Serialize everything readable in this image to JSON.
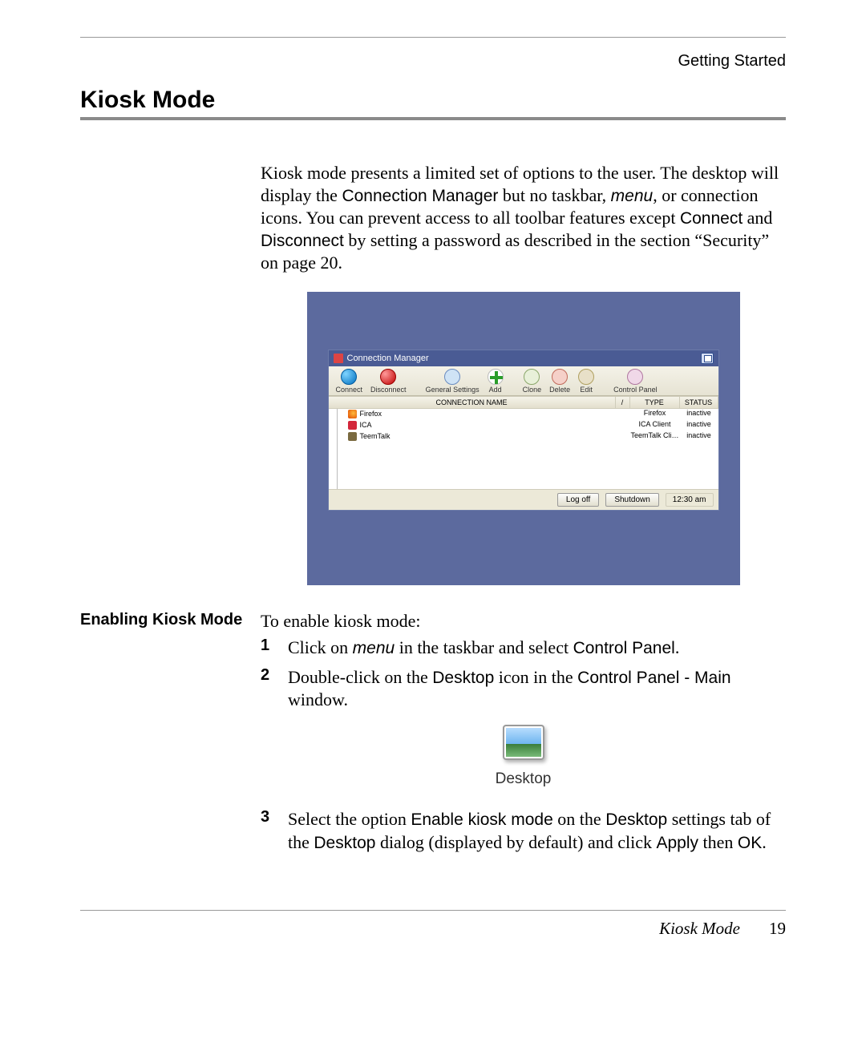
{
  "chapter_header": "Getting Started",
  "section_title": "Kiosk Mode",
  "intro": {
    "p1_a": "Kiosk mode presents a limited set of options to the user. The desktop will display the ",
    "p1_cm": "Connection Manager",
    "p1_b": " but no taskbar, ",
    "p1_menu": "menu",
    "p1_c": ", or connection icons. You can prevent access to all toolbar features except ",
    "p1_connect": "Connect",
    "p1_d": " and ",
    "p1_disconnect": "Disconnect",
    "p1_e": " by setting a password as described in the section “Security” on page 20."
  },
  "screenshot": {
    "window_title": "Connection Manager",
    "toolbar": {
      "connect": "Connect",
      "disconnect": "Disconnect",
      "general_settings": "General Settings",
      "add": "Add",
      "clone": "Clone",
      "delete": "Delete",
      "edit": "Edit",
      "control_panel": "Control Panel"
    },
    "columns": {
      "name": "CONNECTION NAME",
      "type": "TYPE",
      "status": "STATUS"
    },
    "rows": [
      {
        "name": "Firefox",
        "type": "Firefox",
        "status": "inactive"
      },
      {
        "name": "ICA",
        "type": "ICA Client",
        "status": "inactive"
      },
      {
        "name": "TeemTalk",
        "type": "TeemTalk Cli…",
        "status": "inactive"
      }
    ],
    "statusbar": {
      "logoff": "Log off",
      "shutdown": "Shutdown",
      "time": "12:30 am"
    }
  },
  "enable": {
    "side_heading": "Enabling Kiosk Mode",
    "lead": "To enable kiosk mode:",
    "step1_a": "Click on ",
    "step1_menu": "menu",
    "step1_b": " in the taskbar and select ",
    "step1_cp": "Control Panel",
    "step1_c": ".",
    "step2_a": "Double-click on the ",
    "step2_desktop": "Desktop",
    "step2_b": " icon in the ",
    "step2_cpmain": "Control Panel - Main",
    "step2_c": " window.",
    "icon_label": "Desktop",
    "step3_a": "Select the option ",
    "step3_enable": "Enable kiosk mode",
    "step3_b": " on the ",
    "step3_desktop": "Desktop",
    "step3_c": " settings tab of the ",
    "step3_desktop2": "Desktop",
    "step3_d": " dialog (displayed by default) and click ",
    "step3_apply": "Apply",
    "step3_e": " then ",
    "step3_ok": "OK",
    "step3_f": "."
  },
  "footer": {
    "section": "Kiosk Mode",
    "page": "19"
  }
}
